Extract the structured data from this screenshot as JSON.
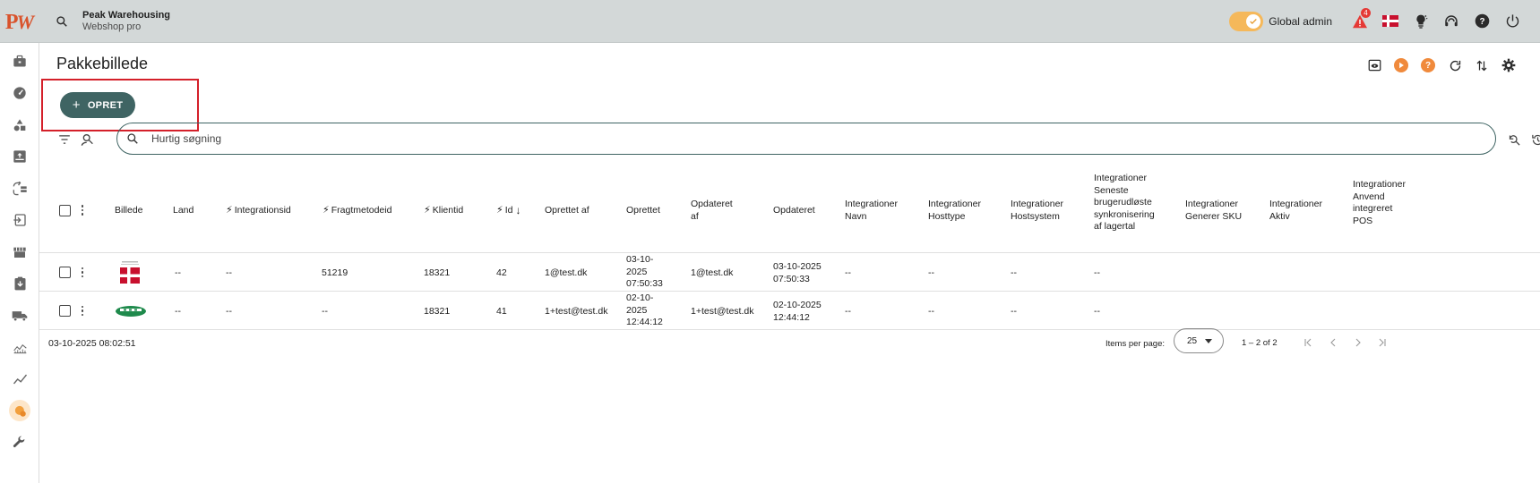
{
  "app": {
    "company_name": "Peak Warehousing",
    "company_sub": "Webshop pro",
    "logo_text": "PW"
  },
  "topbar": {
    "global_admin_label": "Global admin",
    "toggle_on": true,
    "notification_count": "4",
    "icons": [
      "search-icon",
      "warning-icon",
      "flag-dk-icon",
      "lightbulb-icon",
      "support-icon",
      "help-icon",
      "power-icon"
    ]
  },
  "sidebar": {
    "items": [
      {
        "icon": "briefcase-icon"
      },
      {
        "icon": "dashboard-icon"
      },
      {
        "icon": "shapes-icon"
      },
      {
        "icon": "inbox-upload-icon"
      },
      {
        "icon": "transfer-list-icon"
      },
      {
        "icon": "input-icon"
      },
      {
        "icon": "store-icon"
      },
      {
        "icon": "clipboard-download-icon"
      },
      {
        "icon": "truck-icon"
      },
      {
        "icon": "chart-area-icon"
      },
      {
        "icon": "trend-icon"
      },
      {
        "icon": "package-image-icon",
        "active": true
      },
      {
        "icon": "wrench-icon"
      }
    ]
  },
  "page": {
    "title": "Pakkebillede",
    "create_label": "OPRET",
    "search_placeholder": "Hurtig søgning"
  },
  "table": {
    "headers": {
      "billede": "Billede",
      "land": "Land",
      "integrationsid": "Integrationsid",
      "fragtmetodeid": "Fragtmetodeid",
      "klientid": "Klientid",
      "id": "Id",
      "oprettet_af": "Oprettet af",
      "oprettet": "Oprettet",
      "opdateret_af_1": "Opdateret",
      "opdateret_af_2": "af",
      "opdateret": "Opdateret",
      "int_navn_1": "Integrationer",
      "int_navn_2": "Navn",
      "int_hosttype_1": "Integrationer",
      "int_hosttype_2": "Hosttype",
      "int_hostsystem_1": "Integrationer",
      "int_hostsystem_2": "Hostsystem",
      "int_seneste_1": "Integrationer",
      "int_seneste_2": "Seneste",
      "int_seneste_3": "brugerudløste",
      "int_seneste_4": "synkronisering",
      "int_seneste_5": "af lagertal",
      "int_sku_1": "Integrationer",
      "int_sku_2": "Generer SKU",
      "int_aktiv_1": "Integrationer",
      "int_aktiv_2": "Aktiv",
      "int_pos_1": "Integrationer",
      "int_pos_2": "Anvend",
      "int_pos_3": "integreret",
      "int_pos_4": "POS"
    },
    "rows": [
      {
        "image": "flag-dk-package-image",
        "land": "--",
        "integrationsid": "--",
        "fragtmetodeid": "51219",
        "klientid": "18321",
        "id": "42",
        "oprettet_af": "1@test.dk",
        "oprettet_1": "03-10-",
        "oprettet_2": "2025",
        "oprettet_3": "07:50:33",
        "opdateret_af": "1@test.dk",
        "opdateret_1": "03-10-2025",
        "opdateret_2": "07:50:33",
        "int_navn": "--",
        "int_hosttype": "--",
        "int_hostsystem": "--",
        "int_seneste": "--"
      },
      {
        "image": "boat-package-image",
        "land": "--",
        "integrationsid": "--",
        "fragtmetodeid": "--",
        "klientid": "18321",
        "id": "41",
        "oprettet_af": "1+test@test.dk",
        "oprettet_1": "02-10-",
        "oprettet_2": "2025",
        "oprettet_3": "12:44:12",
        "opdateret_af": "1+test@test.dk",
        "opdateret_1": "02-10-2025",
        "opdateret_2": "12:44:12",
        "int_navn": "--",
        "int_hosttype": "--",
        "int_hostsystem": "--",
        "int_seneste": "--"
      }
    ]
  },
  "footer": {
    "timestamp": "03-10-2025 08:02:51",
    "items_per_page_label": "Items per page:",
    "items_per_page_value": "25",
    "range": "1 – 2 of 2"
  },
  "colors": {
    "accent": "#3f6463",
    "topbar": "#d3d8d8",
    "toggle": "#f5b85a",
    "highlight": "#d4202a"
  }
}
